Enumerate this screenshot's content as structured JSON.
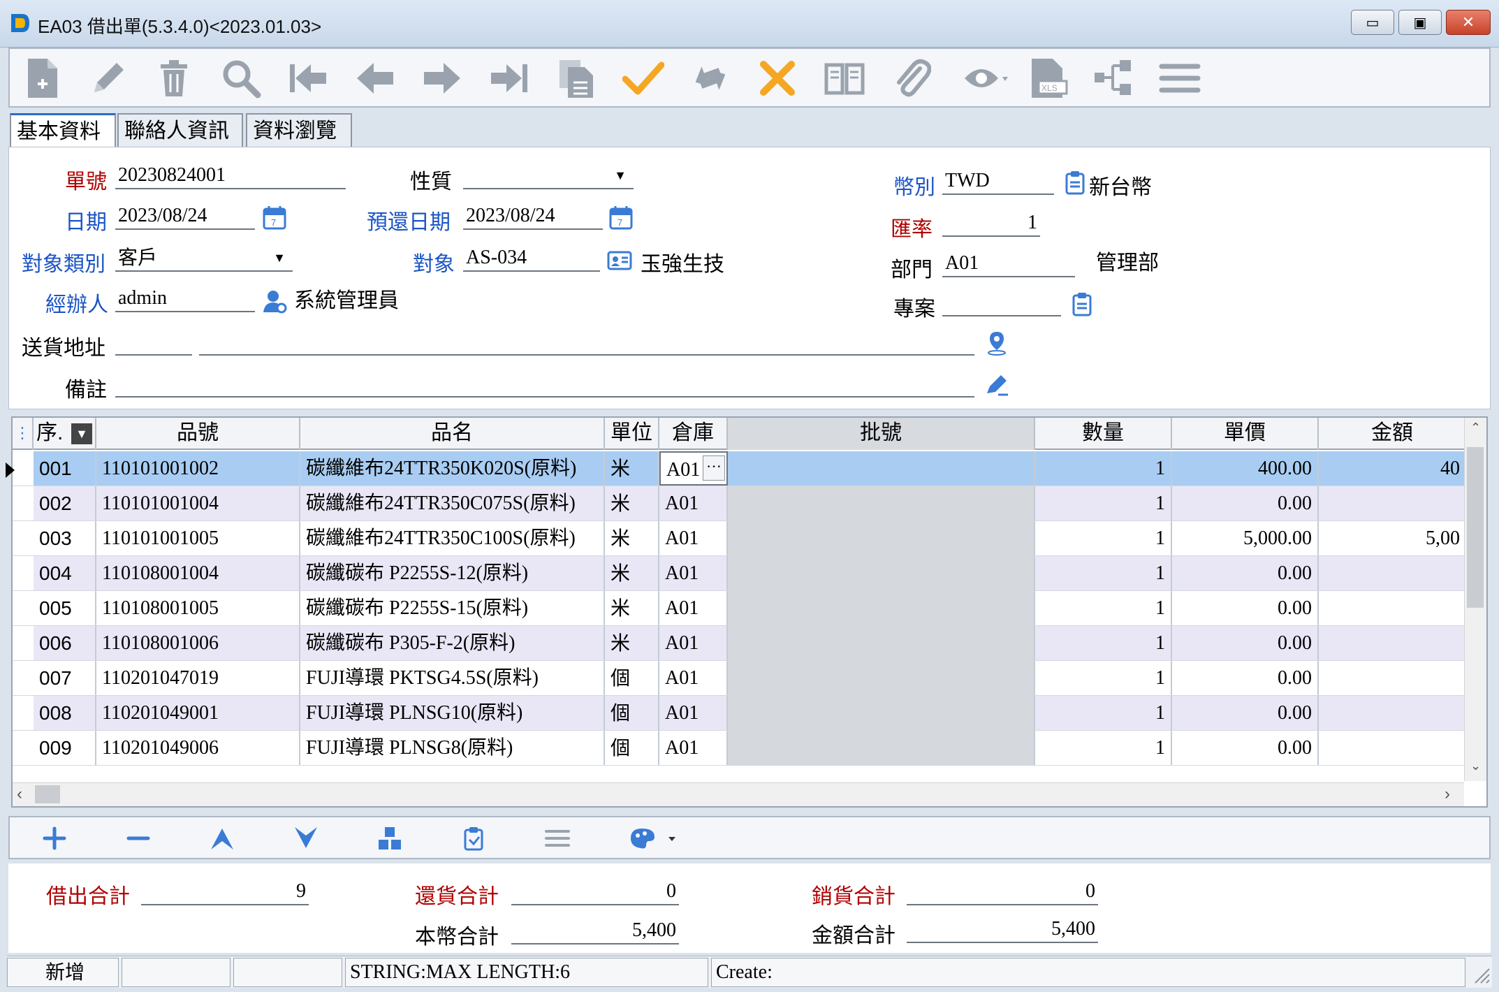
{
  "window": {
    "title": "EA03 借出單(5.3.4.0)<2023.01.03>",
    "min_glyph": "▭",
    "max_glyph": "▣",
    "close_glyph": "✕"
  },
  "toolbar_icons": [
    "new-doc-icon",
    "edit-pencil-icon",
    "delete-trash-icon",
    "search-icon",
    "first-record-icon",
    "prev-record-icon",
    "next-record-icon",
    "last-record-icon",
    "copy-icon",
    "confirm-check-icon",
    "refresh-icon",
    "cancel-x-icon",
    "open-book-icon",
    "attachment-icon",
    "eye-icon",
    "excel-export-icon",
    "flow-icon",
    "menu-icon"
  ],
  "colors": {
    "accent_orange": "#f5a623",
    "icon_gray": "#9aa3ad",
    "label_red": "#b00000",
    "label_blue": "#1b55c4",
    "selected_row": "#a9cdf2",
    "alt_row": "#e9e7f6",
    "icon_blue": "#3a7bd5"
  },
  "tabs": [
    "基本資料",
    "聯絡人資訊",
    "資料瀏覽"
  ],
  "form": {
    "doc_no_label": "單號",
    "doc_no": "20230824001",
    "nature_label": "性質",
    "nature": "",
    "currency_label": "幣別",
    "currency": "TWD",
    "currency_name": "新台幣",
    "date_label": "日期",
    "date": "2023/08/24",
    "return_date_label": "預還日期",
    "return_date": "2023/08/24",
    "rate_label": "匯率",
    "rate": "1",
    "obj_type_label": "對象類別",
    "obj_type": "客戶",
    "obj_label": "對象",
    "obj": "AS-034",
    "obj_name": "玉強生技",
    "dept_label": "部門",
    "dept": "A01",
    "dept_name": "管理部",
    "handler_label": "經辦人",
    "handler": "admin",
    "handler_name": "系統管理員",
    "project_label": "專案",
    "project": "",
    "address_label": "送貨地址",
    "address1": "",
    "address2": "",
    "remark_label": "備註",
    "remark": ""
  },
  "grid": {
    "headers": [
      "序.",
      "品號",
      "品名",
      "單位",
      "倉庫",
      "批號",
      "數量",
      "單價",
      "金額"
    ],
    "rows": [
      {
        "seq": "001",
        "code": "110101001002",
        "name": "碳纖維布24TTR350K020S(原料)",
        "unit": "米",
        "wh": "A01",
        "batch": "",
        "qty": "1",
        "price": "400.00",
        "amount": "40"
      },
      {
        "seq": "002",
        "code": "110101001004",
        "name": "碳纖維布24TTR350C075S(原料)",
        "unit": "米",
        "wh": "A01",
        "batch": "",
        "qty": "1",
        "price": "0.00",
        "amount": ""
      },
      {
        "seq": "003",
        "code": "110101001005",
        "name": "碳纖維布24TTR350C100S(原料)",
        "unit": "米",
        "wh": "A01",
        "batch": "",
        "qty": "1",
        "price": "5,000.00",
        "amount": "5,00"
      },
      {
        "seq": "004",
        "code": "110108001004",
        "name": "碳纖碳布 P2255S-12(原料)",
        "unit": "米",
        "wh": "A01",
        "batch": "",
        "qty": "1",
        "price": "0.00",
        "amount": ""
      },
      {
        "seq": "005",
        "code": "110108001005",
        "name": "碳纖碳布 P2255S-15(原料)",
        "unit": "米",
        "wh": "A01",
        "batch": "",
        "qty": "1",
        "price": "0.00",
        "amount": ""
      },
      {
        "seq": "006",
        "code": "110108001006",
        "name": "碳纖碳布 P305-F-2(原料)",
        "unit": "米",
        "wh": "A01",
        "batch": "",
        "qty": "1",
        "price": "0.00",
        "amount": ""
      },
      {
        "seq": "007",
        "code": "110201047019",
        "name": "FUJI導環 PKTSG4.5S(原料)",
        "unit": "個",
        "wh": "A01",
        "batch": "",
        "qty": "1",
        "price": "0.00",
        "amount": ""
      },
      {
        "seq": "008",
        "code": "110201049001",
        "name": "FUJI導環 PLNSG10(原料)",
        "unit": "個",
        "wh": "A01",
        "batch": "",
        "qty": "1",
        "price": "0.00",
        "amount": ""
      },
      {
        "seq": "009",
        "code": "110201049006",
        "name": "FUJI導環 PLNSG8(原料)",
        "unit": "個",
        "wh": "A01",
        "batch": "",
        "qty": "1",
        "price": "0.00",
        "amount": ""
      }
    ],
    "ellipsis": "···"
  },
  "grid_toolbar_icons": [
    "add-row-icon",
    "remove-row-icon",
    "move-up-icon",
    "move-down-icon",
    "insert-block-icon",
    "paste-icon",
    "list-icon",
    "palette-icon"
  ],
  "totals": {
    "lend_label": "借出合計",
    "lend": "9",
    "return_label": "還貨合計",
    "return": "0",
    "sale_label": "銷貨合計",
    "sale": "0",
    "local_label": "本幣合計",
    "local": "5,400",
    "amount_label": "金額合計",
    "amount": "5,400"
  },
  "status": {
    "mode": "新增",
    "cell2": "",
    "cell3": "",
    "hint": "STRING:MAX LENGTH:6",
    "create": "Create:"
  }
}
